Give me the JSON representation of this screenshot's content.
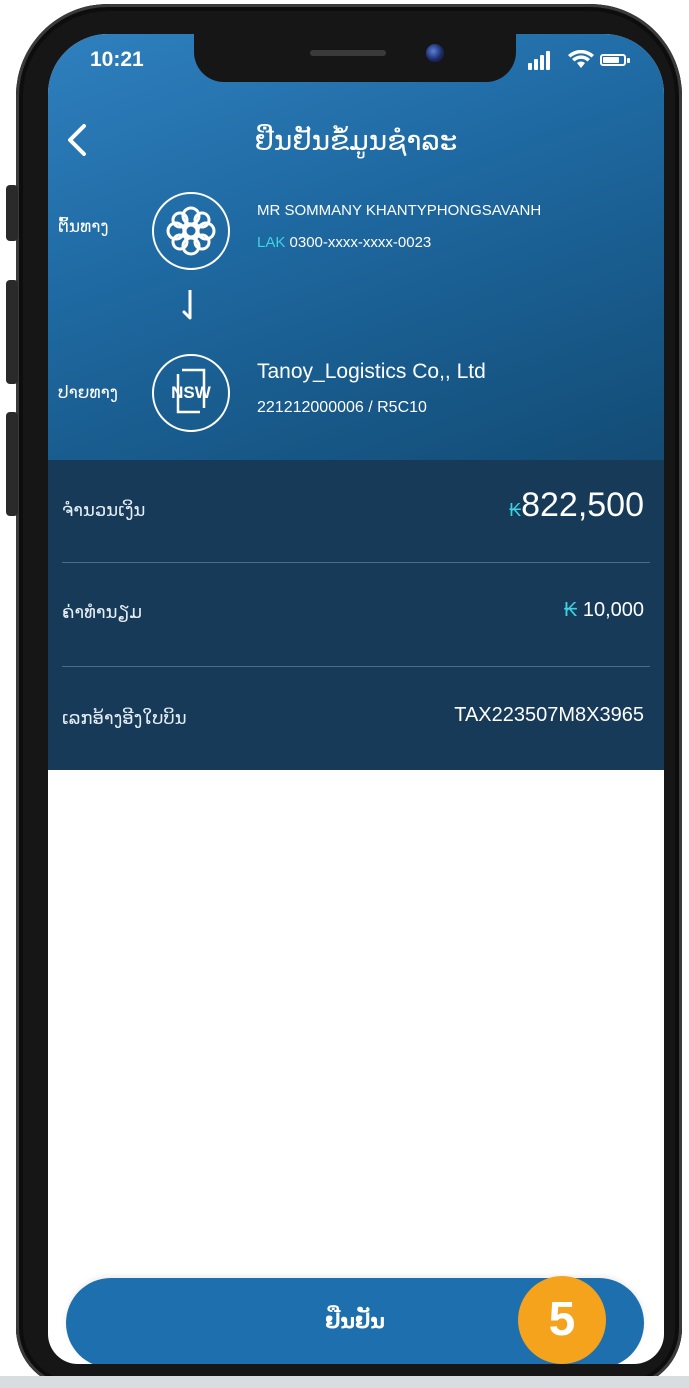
{
  "status_bar": {
    "time": "10:21"
  },
  "header": {
    "title": "ຢືນຢັນຂໍ້ມູນຊຳລະ"
  },
  "source": {
    "label": "ຕົ້ນທາງ",
    "name": "MR SOMMANY KHANTYPHONGSAVANH",
    "currency": "LAK",
    "account": "0300-xxxx-xxxx-0023"
  },
  "destination": {
    "label": "ປາຍທາງ",
    "name": "Tanoy_Logistics Co,, Ltd",
    "reference": "221212000006 / R5C10",
    "logo_text": "NSW"
  },
  "summary": {
    "amount_label": "ຈຳນວນເງິນ",
    "amount_currency": "₭",
    "amount_value": "822,500",
    "fee_label": "ຄ່າທຳນຽມ",
    "fee_currency": "₭",
    "fee_value": "10,000",
    "ref_label": "ເລກອ້າງອີງໃບບິນ",
    "ref_value": "TAX223507M8X3965"
  },
  "actions": {
    "confirm_label": "ຢືນຢັນ"
  },
  "annotation": {
    "step_number": "5"
  },
  "colors": {
    "header_gradient_start": "#2f80bf",
    "header_gradient_end": "#134b74",
    "summary_bg": "#163a58",
    "accent_cyan": "#3fd3e0",
    "button_blue": "#1d6fae",
    "badge_orange": "#f5a31c"
  }
}
